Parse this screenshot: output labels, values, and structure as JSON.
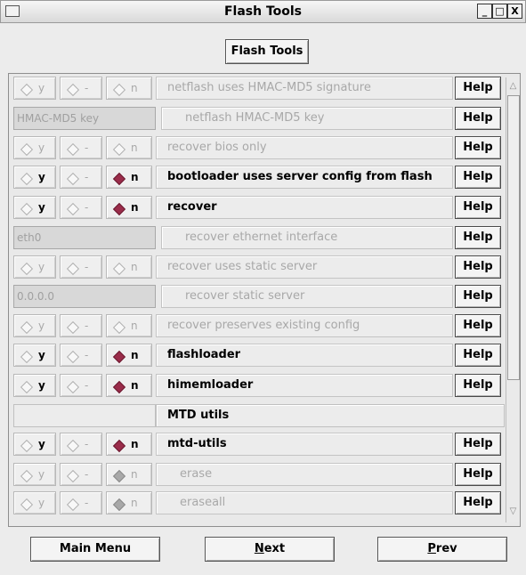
{
  "window": {
    "title": "Flash Tools",
    "minimize_label": "_",
    "maximize_label": "□",
    "close_label": "X"
  },
  "header_button": "Flash Tools",
  "labels": {
    "y": "y",
    "m": "-",
    "n": "n",
    "help": "Help"
  },
  "rows": [
    {
      "type": "tristate",
      "label": "netflash uses HMAC-MD5 signature",
      "selected": "none",
      "enabled": false
    },
    {
      "type": "text",
      "value": "HMAC-MD5 key",
      "label": "netflash HMAC-MD5 key"
    },
    {
      "type": "tristate",
      "label": "recover bios only",
      "selected": "none",
      "enabled": false
    },
    {
      "type": "tristate",
      "label": "bootloader uses server config from flash",
      "selected": "n",
      "enabled": true
    },
    {
      "type": "tristate",
      "label": "recover",
      "selected": "n",
      "enabled": true
    },
    {
      "type": "text",
      "value": "eth0",
      "label": "recover ethernet interface"
    },
    {
      "type": "tristate",
      "label": "recover uses static server",
      "selected": "none",
      "enabled": false
    },
    {
      "type": "text",
      "value": "0.0.0.0",
      "label": "recover static server"
    },
    {
      "type": "tristate",
      "label": "recover preserves existing config",
      "selected": "none",
      "enabled": false
    },
    {
      "type": "tristate",
      "label": "flashloader",
      "selected": "n",
      "enabled": true
    },
    {
      "type": "tristate",
      "label": "himemloader",
      "selected": "n",
      "enabled": true
    },
    {
      "type": "section",
      "label": "MTD utils"
    },
    {
      "type": "tristate",
      "label": "mtd-utils",
      "selected": "n",
      "enabled": true
    },
    {
      "type": "tristate",
      "label": "erase",
      "selected": "n-grey",
      "enabled": false,
      "indent": true
    },
    {
      "type": "tristate",
      "label": "eraseall",
      "selected": "n-grey",
      "enabled": false,
      "indent": true
    }
  ],
  "buttons": {
    "main_menu": "Main Menu",
    "next_underlined": "N",
    "next_rest": "ext",
    "prev_underlined": "P",
    "prev_rest": "rev"
  },
  "colors": {
    "selected_radio": "#9a2c4a",
    "disabled_text": "#a8a8a8"
  },
  "icons": {
    "radio": "diamond-radio-icon",
    "scroll_up": "scroll-up-arrow-icon",
    "scroll_down": "scroll-down-arrow-icon"
  }
}
